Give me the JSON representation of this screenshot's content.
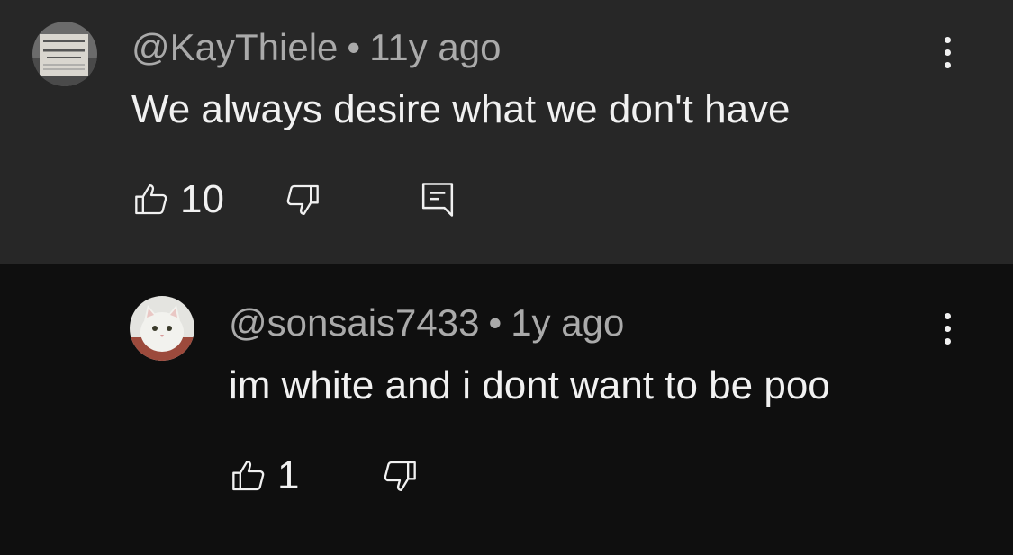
{
  "comments": [
    {
      "handle": "@KayThiele",
      "separator": "•",
      "time": "11y ago",
      "text": "We always desire what we don't have",
      "likes": "10",
      "has_reply_button": true,
      "avatar_icon": "newspaper-avatar",
      "avatar_text": "DYSLEXIA FOR CURE FOUND"
    },
    {
      "handle": "@sonsais7433",
      "separator": "•",
      "time": "1y ago",
      "text": "im white and i dont want to be poo",
      "likes": "1",
      "has_reply_button": false,
      "avatar_icon": "cat-avatar"
    }
  ],
  "icons": {
    "like": "thumbs-up-icon",
    "dislike": "thumbs-down-icon",
    "reply": "reply-icon",
    "menu": "more-vertical-icon"
  },
  "colors": {
    "top_bg": "#272727",
    "reply_bg": "#0f0f0f",
    "meta_text": "#aaaaaa",
    "main_text": "#f1f1f1"
  }
}
